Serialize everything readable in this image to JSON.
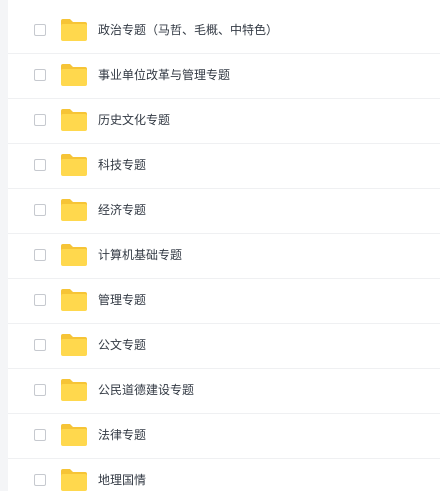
{
  "file_list": {
    "items": [
      {
        "name": "政治专题（马哲、毛概、中特色）",
        "icon": "folder-icon",
        "checked": false
      },
      {
        "name": "事业单位改革与管理专题",
        "icon": "folder-icon",
        "checked": false
      },
      {
        "name": "历史文化专题",
        "icon": "folder-icon",
        "checked": false
      },
      {
        "name": "科技专题",
        "icon": "folder-icon",
        "checked": false
      },
      {
        "name": "经济专题",
        "icon": "folder-icon",
        "checked": false
      },
      {
        "name": "计算机基础专题",
        "icon": "folder-icon",
        "checked": false
      },
      {
        "name": "管理专题",
        "icon": "folder-icon",
        "checked": false
      },
      {
        "name": "公文专题",
        "icon": "folder-icon",
        "checked": false
      },
      {
        "name": "公民道德建设专题",
        "icon": "folder-icon",
        "checked": false
      },
      {
        "name": "法律专题",
        "icon": "folder-icon",
        "checked": false
      },
      {
        "name": "地理国情",
        "icon": "folder-icon",
        "checked": false
      }
    ]
  },
  "colors": {
    "folder_body": "#FFD84D",
    "folder_tab": "#F6C436",
    "text": "#333A44",
    "divider": "#EFF0F2",
    "checkbox_border": "#C6C9CF"
  }
}
